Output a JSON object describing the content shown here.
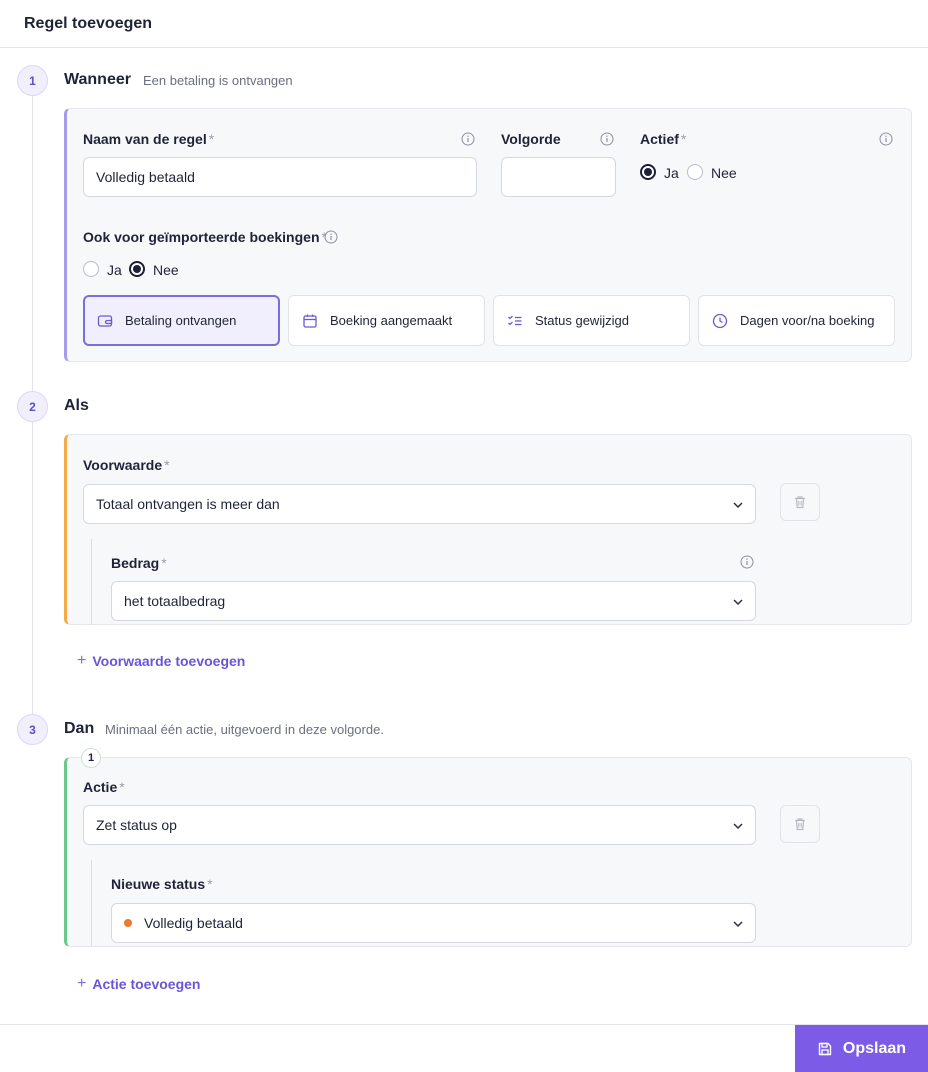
{
  "header": {
    "title": "Regel toevoegen"
  },
  "steps": {
    "step1": {
      "number": "1",
      "title": "Wanneer",
      "subtitle": "Een betaling is ontvangen"
    },
    "step2": {
      "number": "2",
      "title": "Als"
    },
    "step3": {
      "number": "3",
      "title": "Dan",
      "subtitle": "Minimaal één actie, uitgevoerd in deze volgorde."
    }
  },
  "when": {
    "name_label": "Naam van de regel",
    "name_value": "Volledig betaald",
    "order_label": "Volgorde",
    "order_value": "",
    "active_label": "Actief",
    "active_yes": "Ja",
    "active_no": "Nee",
    "imported_label": "Ook voor geïmporteerde boekingen",
    "imported_yes": "Ja",
    "imported_no": "Nee",
    "required_mark": "*",
    "triggers": [
      {
        "label": "Betaling ontvangen",
        "icon": "wallet-icon",
        "active": true
      },
      {
        "label": "Boeking aangemaakt",
        "icon": "calendar-icon",
        "active": false
      },
      {
        "label": "Status gewijzigd",
        "icon": "checklist-icon",
        "active": false
      },
      {
        "label": "Dagen voor/na boeking",
        "icon": "clock-icon",
        "active": false
      }
    ]
  },
  "if": {
    "condition_label": "Voorwaarde",
    "condition_value": "Totaal ontvangen is meer dan",
    "amount_label": "Bedrag",
    "amount_value": "het totaalbedrag",
    "add_condition": "Voorwaarde toevoegen"
  },
  "then": {
    "action_number": "1",
    "action_label": "Actie",
    "action_value": "Zet status op",
    "new_status_label": "Nieuwe status",
    "new_status_value": "Volledig betaald",
    "status_color": "#f07a2a",
    "add_action": "Actie toevoegen"
  },
  "footer": {
    "save_label": "Opslaan"
  },
  "colors": {
    "accent": "#7c5ce6",
    "step1_border": "#a79ae8",
    "step2_border": "#f2ab46",
    "step3_border": "#6bc88a"
  }
}
